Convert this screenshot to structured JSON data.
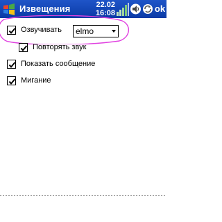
{
  "titlebar": {
    "title": "Извещения",
    "date": "22.02",
    "time": "16:08",
    "ok_label": "ok"
  },
  "settings": {
    "voice": {
      "label": "Озвучивать",
      "checked": true,
      "sound_value": "elmo"
    },
    "repeat": {
      "label": "Повторять звук",
      "checked": true
    },
    "show_message": {
      "label": "Показать сообщение",
      "checked": true
    },
    "blink": {
      "label": "Мигание",
      "checked": true
    }
  },
  "colors": {
    "titlebar": "#1f55c8",
    "highlight_ellipse": "#e040e0"
  },
  "icons": [
    "windows-start-icon",
    "signal-icon",
    "speaker-icon",
    "sync-icon",
    "checkmark-icon"
  ]
}
